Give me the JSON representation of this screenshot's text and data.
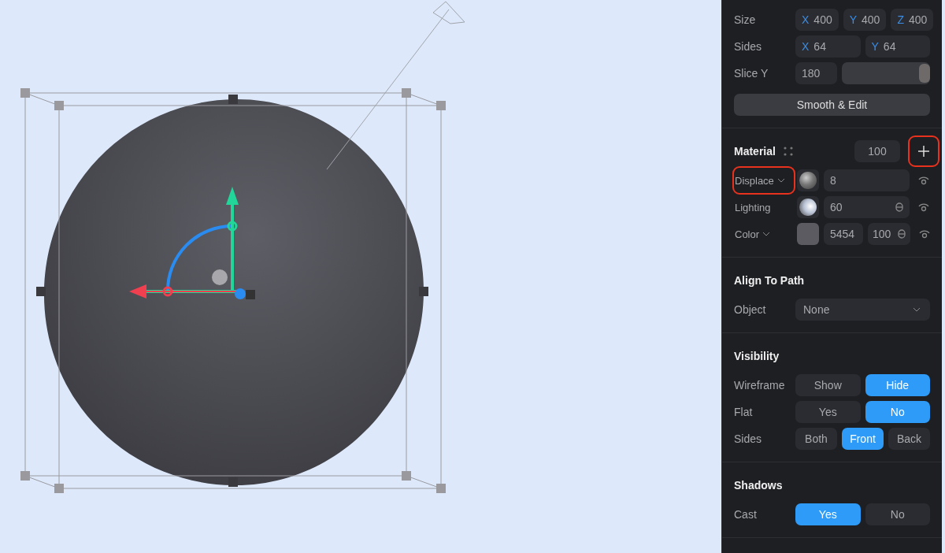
{
  "geometry": {
    "rows": [
      {
        "label": "Size",
        "kind": "axes",
        "fields": [
          {
            "axis": "X",
            "value": "400"
          },
          {
            "axis": "Y",
            "value": "400"
          },
          {
            "axis": "Z",
            "value": "400"
          }
        ]
      },
      {
        "label": "Sides",
        "kind": "axes",
        "fields": [
          {
            "axis": "X",
            "value": "64"
          },
          {
            "axis": "Y",
            "value": "64"
          }
        ]
      },
      {
        "label": "Slice Y",
        "kind": "slider",
        "value": "180",
        "level": 1.0
      }
    ],
    "button": "Smooth & Edit"
  },
  "material": {
    "title": "Material",
    "opacity": "100",
    "add_highlighted": true,
    "layers": [
      {
        "name": "Displace",
        "kind": "displace",
        "dropdown": true,
        "highlighted": true,
        "value": "8",
        "linked": false
      },
      {
        "name": "Lighting",
        "kind": "lighting",
        "dropdown": false,
        "highlighted": false,
        "value": "60",
        "linked": true
      },
      {
        "name": "Color",
        "kind": "color",
        "dropdown": true,
        "highlighted": false,
        "value": "5454",
        "alpha": "100",
        "linked": true
      }
    ]
  },
  "align": {
    "title": "Align To Path",
    "label": "Object",
    "value": "None"
  },
  "visibility": {
    "title": "Visibility",
    "rows": [
      {
        "label": "Wireframe",
        "options": [
          {
            "label": "Show",
            "selected": false
          },
          {
            "label": "Hide",
            "selected": true
          }
        ]
      },
      {
        "label": "Flat",
        "options": [
          {
            "label": "Yes",
            "selected": false
          },
          {
            "label": "No",
            "selected": true
          }
        ]
      },
      {
        "label": "Sides",
        "options": [
          {
            "label": "Both",
            "selected": false
          },
          {
            "label": "Front",
            "selected": true
          },
          {
            "label": "Back",
            "selected": false
          }
        ]
      }
    ]
  },
  "shadows": {
    "title": "Shadows",
    "rows": [
      {
        "label": "Cast",
        "options": [
          {
            "label": "Yes",
            "selected": true
          },
          {
            "label": "No",
            "selected": false
          }
        ]
      }
    ]
  }
}
